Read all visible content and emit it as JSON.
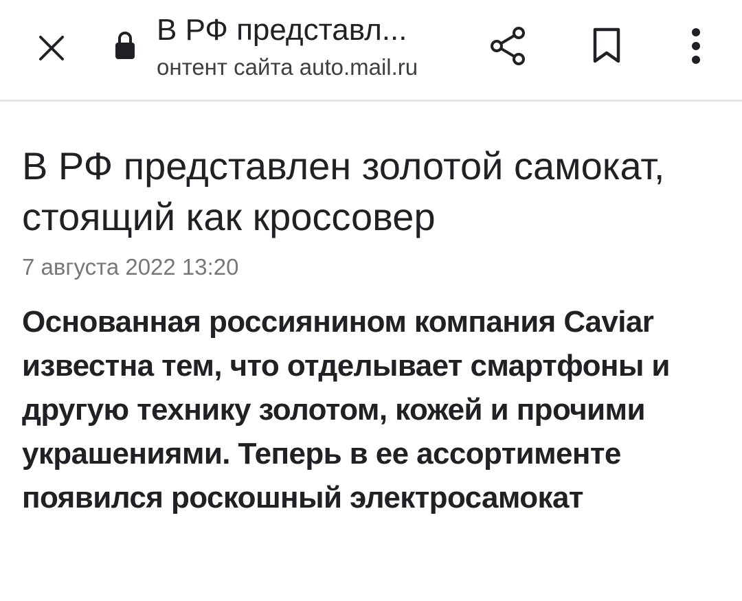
{
  "toolbar": {
    "title": "В РФ представл...",
    "subtitle": "онтент сайта auto.mail.ru",
    "icons": {
      "close": "close-icon",
      "lock": "lock-icon",
      "share": "share-icon",
      "bookmark": "bookmark-icon",
      "menu": "more-vert-icon"
    }
  },
  "article": {
    "headline": "В РФ представлен золотой самокат, стоящий как кроссовер",
    "date": "7 августа 2022 13:20",
    "lead": "Основанная россиянином компания Caviar известна тем, что отделывает смартфоны и другую технику золотом, кожей и прочими украшениями. Теперь в ее ассортименте появился роскошный электросамокат"
  },
  "colors": {
    "text": "#202124",
    "muted": "#777777",
    "divider": "#e4e4e4",
    "background": "#ffffff"
  }
}
